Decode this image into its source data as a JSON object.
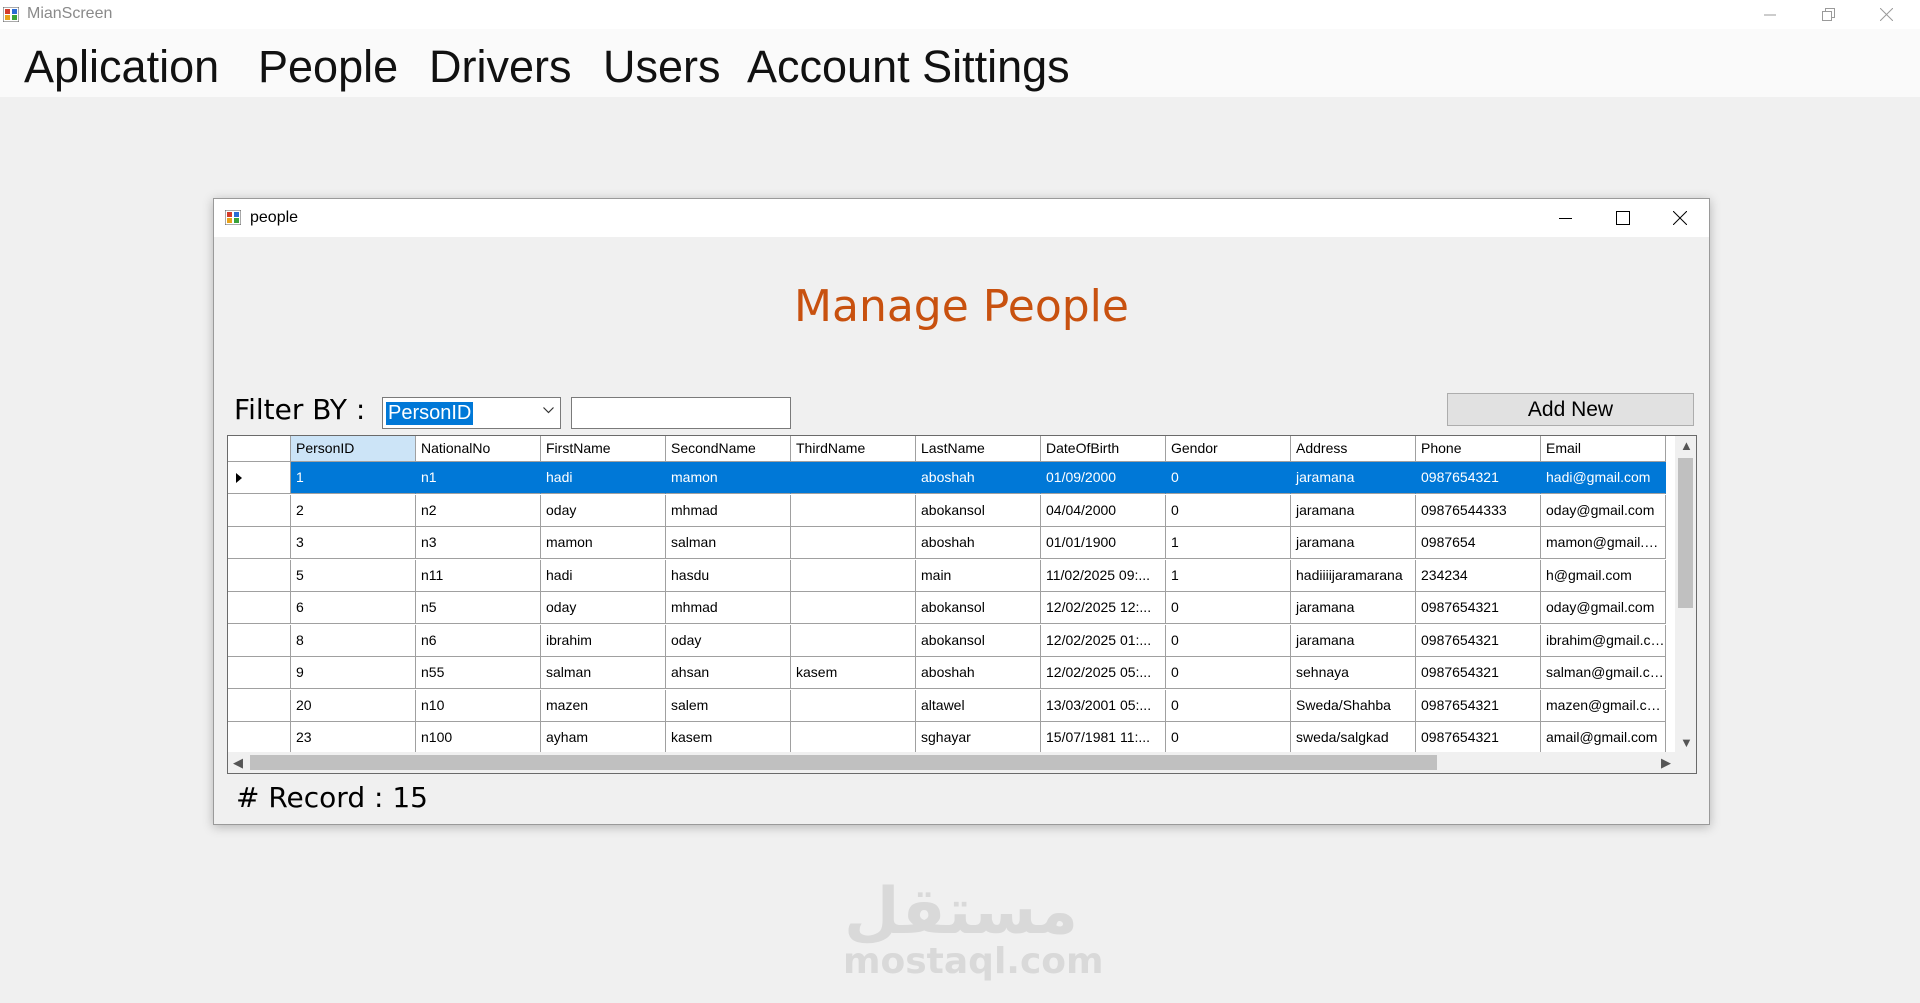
{
  "main_window": {
    "title": "MianScreen",
    "menu": [
      "Aplication",
      "People",
      "Drivers",
      "Users",
      "Account Sittings"
    ]
  },
  "child_window": {
    "title": "people",
    "heading": "Manage People",
    "filter": {
      "label": "Filter BY :",
      "selected": "PersonID",
      "value": ""
    },
    "add_button": "Add New",
    "records": {
      "label": "# Record :",
      "count": "15"
    }
  },
  "table": {
    "columns": [
      "PersonID",
      "NationalNo",
      "FirstName",
      "SecondName",
      "ThirdName",
      "LastName",
      "DateOfBirth",
      "Gendor",
      "Address",
      "Phone",
      "Email"
    ],
    "rows": [
      [
        "1",
        "n1",
        "hadi",
        "mamon",
        "",
        "aboshah",
        "01/09/2000",
        "0",
        "jaramana",
        "0987654321",
        "hadi@gmail.com"
      ],
      [
        "2",
        "n2",
        "oday",
        "mhmad",
        "",
        "abokansol",
        "04/04/2000",
        "0",
        "jaramana",
        "09876544333",
        "oday@gmail.com"
      ],
      [
        "3",
        "n3",
        "mamon",
        "salman",
        "",
        "aboshah",
        "01/01/1900",
        "1",
        "jaramana",
        "0987654",
        "mamon@gmail.com"
      ],
      [
        "5",
        "n11",
        "hadi",
        "hasdu",
        "",
        "main",
        "11/02/2025 09:...",
        "1",
        "hadiiiijaramarana",
        "234234",
        "h@gmail.com"
      ],
      [
        "6",
        "n5",
        "oday",
        "mhmad",
        "",
        "abokansol",
        "12/02/2025 12:...",
        "0",
        "jaramana",
        "0987654321",
        "oday@gmail.com"
      ],
      [
        "8",
        "n6",
        "ibrahim",
        "oday",
        "",
        "abokansol",
        "12/02/2025 01:...",
        "0",
        "jaramana",
        "0987654321",
        "ibrahim@gmail.com"
      ],
      [
        "9",
        "n55",
        "salman",
        "ahsan",
        "kasem",
        "aboshah",
        "12/02/2025 05:...",
        "0",
        "sehnaya",
        "0987654321",
        "salman@gmail.com"
      ],
      [
        "20",
        "n10",
        "mazen",
        "salem",
        "",
        "altawel",
        "13/03/2001 05:...",
        "0",
        "Sweda/Shahba",
        "0987654321",
        "mazen@gmail.com"
      ],
      [
        "23",
        "n100",
        "ayham",
        "kasem",
        "",
        "sghayar",
        "15/07/1981 11:...",
        "0",
        "sweda/salgkad",
        "0987654321",
        "amail@gmail.com"
      ]
    ],
    "selected_row": 0
  },
  "watermark": {
    "arabic": "مستقل",
    "latin": "mostaql.com"
  },
  "colors": {
    "heading": "#c8510f",
    "selection": "#0078d7"
  },
  "icons": [
    "app-icon",
    "minimize-icon",
    "restore-icon",
    "maximize-icon",
    "close-icon",
    "dropdown-arrow-icon",
    "row-pointer-icon"
  ]
}
